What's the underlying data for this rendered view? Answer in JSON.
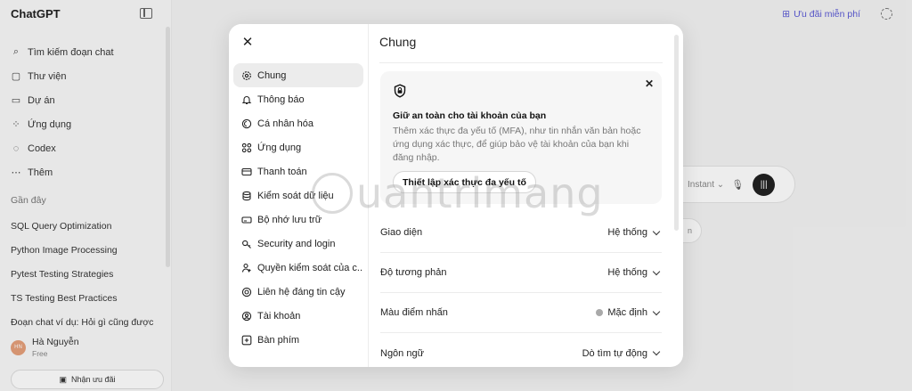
{
  "app": {
    "brand": "ChatGPT",
    "nav": [
      {
        "icon": "search-icon",
        "label": "Tìm kiếm đoạn chat"
      },
      {
        "icon": "library-icon",
        "label": "Thư viện"
      },
      {
        "icon": "folder-icon",
        "label": "Dự án"
      },
      {
        "icon": "apps-icon",
        "label": "Ứng dụng"
      },
      {
        "icon": "codex-icon",
        "label": "Codex"
      },
      {
        "icon": "more-icon",
        "label": "Thêm"
      }
    ],
    "recent_heading": "Gần đây",
    "recent_chats": [
      "SQL Query Optimization",
      "Python Image Processing",
      "Pytest Testing Strategies",
      "TS Testing Best Practices",
      "Đoạn chat ví dụ: Hỏi gì cũng được"
    ],
    "user": {
      "initials": "HN",
      "name": "Hà Nguyễn",
      "plan": "Free"
    },
    "offer_button": "Nhận ưu đãi",
    "top_promo": "Ưu đãi miễn phí",
    "composer": {
      "mode": "Instant"
    }
  },
  "modal": {
    "title": "Chung",
    "nav": [
      {
        "icon": "gear-icon",
        "label": "Chung",
        "active": true
      },
      {
        "icon": "bell-icon",
        "label": "Thông báo"
      },
      {
        "icon": "personalize-icon",
        "label": "Cá nhân hóa"
      },
      {
        "icon": "apps-icon",
        "label": "Ứng dụng"
      },
      {
        "icon": "card-icon",
        "label": "Thanh toán"
      },
      {
        "icon": "database-icon",
        "label": "Kiểm soát dữ liệu"
      },
      {
        "icon": "memory-icon",
        "label": "Bộ nhớ lưu trữ"
      },
      {
        "icon": "security-icon",
        "label": "Security and login"
      },
      {
        "icon": "parental-icon",
        "label": "Quyền kiểm soát của c..."
      },
      {
        "icon": "lifebuoy-icon",
        "label": "Liên hệ đáng tin cậy"
      },
      {
        "icon": "account-icon",
        "label": "Tài khoản"
      },
      {
        "icon": "keyboard-icon",
        "label": "Bàn phím"
      }
    ],
    "mfa": {
      "heading": "Giữ an toàn cho tài khoản của bạn",
      "description": "Thêm xác thực đa yếu tố (MFA), như tin nhắn văn bản hoặc ứng dụng xác thực, để giúp bảo vệ tài khoản của bạn khi đăng nhập.",
      "button": "Thiết lập xác thực đa yếu tố"
    },
    "settings": [
      {
        "label": "Giao diện",
        "value": "Hệ thống",
        "dot": false
      },
      {
        "label": "Độ tương phản",
        "value": "Hệ thống",
        "dot": false
      },
      {
        "label": "Màu điểm nhấn",
        "value": "Mặc định",
        "dot": true
      },
      {
        "label": "Ngôn ngữ",
        "value": "Dò tìm tự động",
        "dot": false
      }
    ]
  },
  "watermark": "uantrimang",
  "colors": {
    "accent": "#5b5ad6",
    "active_bg": "#ececec",
    "dot": "#a9a9a9"
  }
}
